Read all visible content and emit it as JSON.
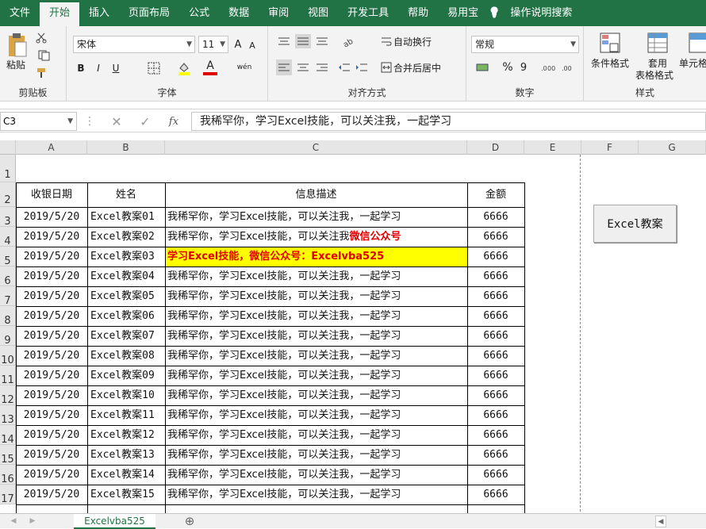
{
  "menu": [
    "文件",
    "开始",
    "插入",
    "页面布局",
    "公式",
    "数据",
    "审阅",
    "视图",
    "开发工具",
    "帮助",
    "易用宝",
    "操作说明搜索"
  ],
  "ribbon": {
    "clipboard_label": "剪贴板",
    "paste": "粘贴",
    "font_name": "宋体",
    "font_size": "11",
    "bold": "B",
    "italic": "I",
    "underline": "U",
    "font_color": "A",
    "font_label": "字体",
    "wrap_text": "自动换行",
    "merge_center": "合并后居中",
    "align_label": "对齐方式",
    "number_format": "常规",
    "percent": "%",
    "comma": "9",
    "number_label": "数字",
    "cond_format": "条件格式",
    "table_format_1": "套用",
    "table_format_2": "表格格式",
    "cell_style": "单元格",
    "styles_label": "样式",
    "inc_font": "A",
    "dec_font": "A",
    "wen": "wén"
  },
  "formula_bar": {
    "name_box": "C3",
    "formula": "我稀罕你，学习Excel技能，可以关注我，一起学习"
  },
  "columns": [
    "A",
    "B",
    "C",
    "D",
    "E",
    "F",
    "G"
  ],
  "rows": [
    "1",
    "2",
    "3",
    "4",
    "5",
    "6",
    "7",
    "8",
    "9",
    "10",
    "11",
    "12",
    "13",
    "14",
    "15",
    "16",
    "17"
  ],
  "table": {
    "headers": [
      "收银日期",
      "姓名",
      "信息描述",
      "金额"
    ],
    "rows": [
      {
        "date": "2019/5/20",
        "name": "Excel教案01",
        "desc": "我稀罕你，学习Excel技能，可以关注我，一起学习",
        "amt": "6666"
      },
      {
        "date": "2019/5/20",
        "name": "Excel教案02",
        "desc": "我稀罕你，学习Excel技能，可以关注我",
        "desc_red": "微信公众号",
        "amt": "6666"
      },
      {
        "date": "2019/5/20",
        "name": "Excel教案03",
        "desc": "学习Excel技能，微信公众号：Excelvba525",
        "amt": "6666",
        "highlight": true
      },
      {
        "date": "2019/5/20",
        "name": "Excel教案04",
        "desc": "我稀罕你，学习Excel技能，可以关注我，一起学习",
        "amt": "6666"
      },
      {
        "date": "2019/5/20",
        "name": "Excel教案05",
        "desc": "我稀罕你，学习Excel技能，可以关注我，一起学习",
        "amt": "6666"
      },
      {
        "date": "2019/5/20",
        "name": "Excel教案06",
        "desc": "我稀罕你，学习Excel技能，可以关注我，一起学习",
        "amt": "6666"
      },
      {
        "date": "2019/5/20",
        "name": "Excel教案07",
        "desc": "我稀罕你，学习Excel技能，可以关注我，一起学习",
        "amt": "6666"
      },
      {
        "date": "2019/5/20",
        "name": "Excel教案08",
        "desc": "我稀罕你，学习Excel技能，可以关注我，一起学习",
        "amt": "6666"
      },
      {
        "date": "2019/5/20",
        "name": "Excel教案09",
        "desc": "我稀罕你，学习Excel技能，可以关注我，一起学习",
        "amt": "6666"
      },
      {
        "date": "2019/5/20",
        "name": "Excel教案10",
        "desc": "我稀罕你，学习Excel技能，可以关注我，一起学习",
        "amt": "6666"
      },
      {
        "date": "2019/5/20",
        "name": "Excel教案11",
        "desc": "我稀罕你，学习Excel技能，可以关注我，一起学习",
        "amt": "6666"
      },
      {
        "date": "2019/5/20",
        "name": "Excel教案12",
        "desc": "我稀罕你，学习Excel技能，可以关注我，一起学习",
        "amt": "6666"
      },
      {
        "date": "2019/5/20",
        "name": "Excel教案13",
        "desc": "我稀罕你，学习Excel技能，可以关注我，一起学习",
        "amt": "6666"
      },
      {
        "date": "2019/5/20",
        "name": "Excel教案14",
        "desc": "我稀罕你，学习Excel技能，可以关注我，一起学习",
        "amt": "6666"
      },
      {
        "date": "2019/5/20",
        "name": "Excel教案15",
        "desc": "我稀罕你，学习Excel技能，可以关注我，一起学习",
        "amt": "6666"
      }
    ]
  },
  "button_label": "Excel教案",
  "sheet_tab": "Excelvba525",
  "colors": {
    "accent": "#217346",
    "red": "#e00000",
    "highlight": "#ffff00"
  }
}
